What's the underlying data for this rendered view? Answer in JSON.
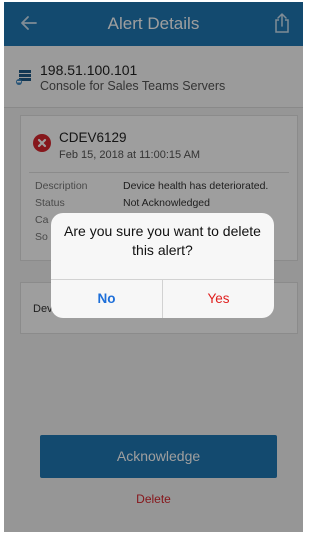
{
  "header": {
    "title": "Alert Details",
    "back_icon": "back-arrow-icon",
    "share_icon": "share-icon",
    "color": "#1f78b4"
  },
  "server": {
    "ip": "198.51.100.101",
    "description": "Console for Sales Teams Servers",
    "icon": "server-icon"
  },
  "alert": {
    "id": "CDEV6129",
    "timestamp": "Feb 15, 2018 at 11:00:15 AM",
    "icon": "error-icon",
    "fields": [
      {
        "label": "Description",
        "value": "Device health has deteriorated."
      },
      {
        "label": "Status",
        "value": "Not Acknowledged"
      },
      {
        "label": "Ca",
        "value": ""
      },
      {
        "label": "So",
        "value": ""
      }
    ]
  },
  "second_card": {
    "label": "Dev"
  },
  "actions": {
    "acknowledge_label": "Acknowledge",
    "delete_label": "Delete"
  },
  "dialog": {
    "message": "Are you sure you want to delete this alert?",
    "no_label": "No",
    "yes_label": "Yes",
    "no_color": "#1e6fd9",
    "yes_color": "#e0201f"
  }
}
